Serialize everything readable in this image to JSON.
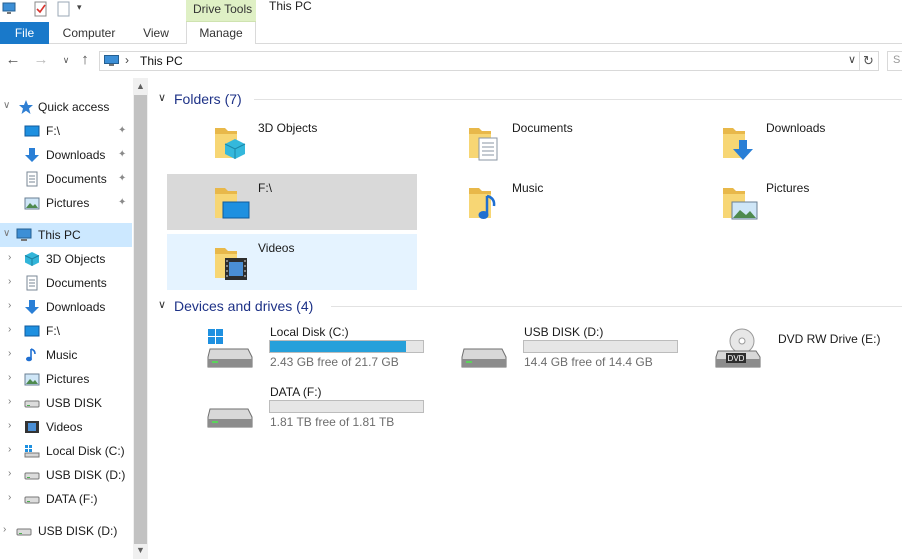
{
  "window": {
    "title": "This PC",
    "context_tab_group": "Drive Tools"
  },
  "ribbon": {
    "tabs": [
      {
        "label": "File"
      },
      {
        "label": "Computer"
      },
      {
        "label": "View"
      },
      {
        "label": "Manage"
      }
    ]
  },
  "address": {
    "path": "This PC",
    "search_placeholder": "S"
  },
  "nav": {
    "items": [
      {
        "label": "Quick access",
        "icon": "star-icon"
      },
      {
        "label": "F:\\",
        "icon": "drive-monitor-icon",
        "pinned": true
      },
      {
        "label": "Downloads",
        "icon": "download-arrow-icon",
        "pinned": true
      },
      {
        "label": "Documents",
        "icon": "document-icon",
        "pinned": true
      },
      {
        "label": "Pictures",
        "icon": "picture-icon",
        "pinned": true
      },
      {
        "label": "This PC",
        "icon": "computer-icon"
      },
      {
        "label": "3D Objects",
        "icon": "cube-icon"
      },
      {
        "label": "Documents",
        "icon": "document-icon"
      },
      {
        "label": "Downloads",
        "icon": "download-arrow-icon"
      },
      {
        "label": "F:\\",
        "icon": "drive-monitor-icon"
      },
      {
        "label": "Music",
        "icon": "music-note-icon"
      },
      {
        "label": "Pictures",
        "icon": "picture-icon"
      },
      {
        "label": "USB DISK",
        "icon": "usb-drive-icon"
      },
      {
        "label": "Videos",
        "icon": "film-icon"
      },
      {
        "label": "Local Disk (C:)",
        "icon": "windows-drive-icon"
      },
      {
        "label": "USB DISK (D:)",
        "icon": "usb-drive-icon"
      },
      {
        "label": "DATA (F:)",
        "icon": "hard-drive-icon"
      },
      {
        "label": "USB DISK (D:)",
        "icon": "usb-drive-icon"
      }
    ]
  },
  "content": {
    "folders_header": "Folders (7)",
    "folders": [
      {
        "name": "3D Objects",
        "overlay": "cube"
      },
      {
        "name": "Documents",
        "overlay": "doc"
      },
      {
        "name": "Downloads",
        "overlay": "down"
      },
      {
        "name": "F:\\",
        "overlay": "monitor"
      },
      {
        "name": "Music",
        "overlay": "note"
      },
      {
        "name": "Pictures",
        "overlay": "pic"
      },
      {
        "name": "Videos",
        "overlay": "film"
      }
    ],
    "drives_header": "Devices and drives (4)",
    "drives": [
      {
        "name": "Local Disk (C:)",
        "free": "2.43 GB free of 21.7 GB",
        "used_fraction": 0.888,
        "type": "windows"
      },
      {
        "name": "USB DISK (D:)",
        "free": "14.4 GB free of 14.4 GB",
        "used_fraction": 0.0,
        "type": "usb"
      },
      {
        "name": "DVD RW Drive (E:)",
        "free": "",
        "type": "dvd",
        "dvd_label": "DVD"
      },
      {
        "name": "DATA (F:)",
        "free": "1.81 TB free of 1.81 TB",
        "used_fraction": 0.0,
        "type": "hdd"
      }
    ]
  },
  "colors": {
    "accent": "#1979ca",
    "selection": "#cce8ff",
    "bar_fill": "#26a0da",
    "group_title": "#1e3287"
  }
}
